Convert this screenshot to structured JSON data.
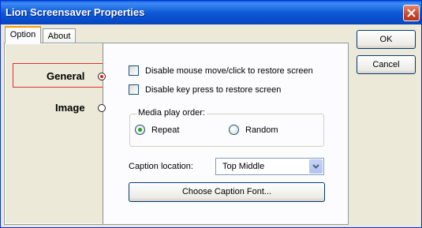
{
  "window": {
    "title": "Lion Screensaver Properties"
  },
  "tabs": [
    {
      "label": "Option",
      "selected": true
    },
    {
      "label": "About",
      "selected": false
    }
  ],
  "nav": [
    {
      "label": "General",
      "selected": true
    },
    {
      "label": "Image",
      "selected": false
    }
  ],
  "options": {
    "disable_mouse": {
      "label": "Disable mouse move/click to restore screen",
      "checked": false
    },
    "disable_key": {
      "label": "Disable key press to restore screen",
      "checked": false
    }
  },
  "media": {
    "legend": "Media play order:",
    "repeat_label": "Repeat",
    "random_label": "Random",
    "selected": "Repeat"
  },
  "caption": {
    "label": "Caption location:",
    "value": "Top Middle",
    "font_button": "Choose Caption Font..."
  },
  "buttons": {
    "ok": "OK",
    "cancel": "Cancel"
  },
  "colors": {
    "titlebar": "#0a5fe0",
    "tab_highlight": "#ff9a00",
    "nav_border": "#e03030"
  }
}
